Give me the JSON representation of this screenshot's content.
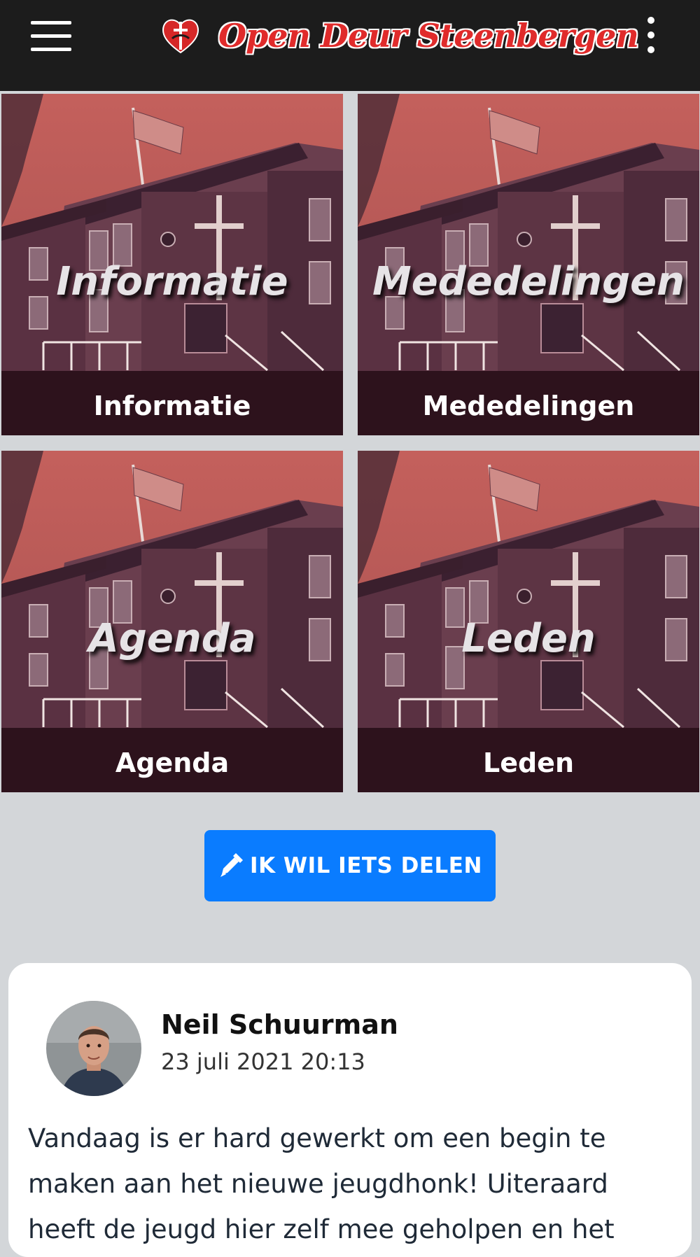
{
  "header": {
    "title": "Open Deur Steenbergen",
    "menu_icon": "hamburger-menu-icon",
    "more_icon": "vertical-dots-icon",
    "logo_icon": "heart-cross-logo",
    "background_color": "#1c1c1c",
    "title_color": "#e02b2b"
  },
  "tiles": [
    {
      "overlay_title": "Informatie",
      "caption": "Informatie"
    },
    {
      "overlay_title": "Mededelingen",
      "caption": "Mededelingen"
    },
    {
      "overlay_title": "Agenda",
      "caption": "Agenda"
    },
    {
      "overlay_title": "Leden",
      "caption": "Leden"
    }
  ],
  "share_button": {
    "label": "IK WIL IETS DELEN",
    "icon": "pen-icon",
    "color": "#0a7cff"
  },
  "post": {
    "author": "Neil Schuurman",
    "timestamp": "23 juli 2021 20:13",
    "text": "Vandaag is er hard gewerkt om een begin te maken aan het nieuwe jeugdhonk! Uiteraard heeft de jeugd hier zelf mee geholpen en het"
  },
  "page": {
    "background_color": "#d3d6d9"
  }
}
